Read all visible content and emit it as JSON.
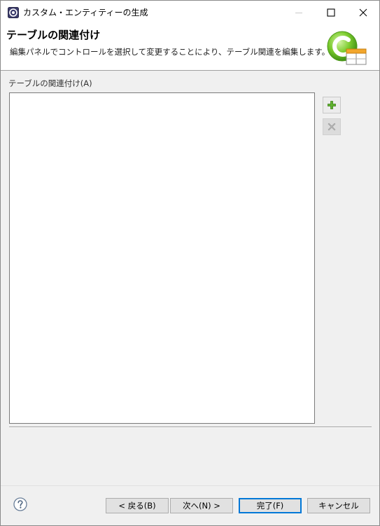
{
  "window": {
    "title": "カスタム・エンティティーの生成"
  },
  "banner": {
    "title": "テーブルの関連付け",
    "description": "編集パネルでコントロールを選択して変更することにより、テーブル関連を編集します。",
    "logo_icon": "wizard-logo-icon"
  },
  "associations": {
    "label": "テーブルの関連付け(A)",
    "items": []
  },
  "side_buttons": {
    "add_icon": "plus-icon",
    "remove_icon": "x-icon"
  },
  "footer": {
    "help_icon": "help-icon",
    "back_label": "< 戻る(B)",
    "next_label": "次へ(N) >",
    "finish_label": "完了(F)",
    "cancel_label": "キャンセル"
  },
  "colors": {
    "accent": "#0078d7",
    "logo_green": "#6cc02a",
    "logo_orange": "#f2a62c"
  }
}
